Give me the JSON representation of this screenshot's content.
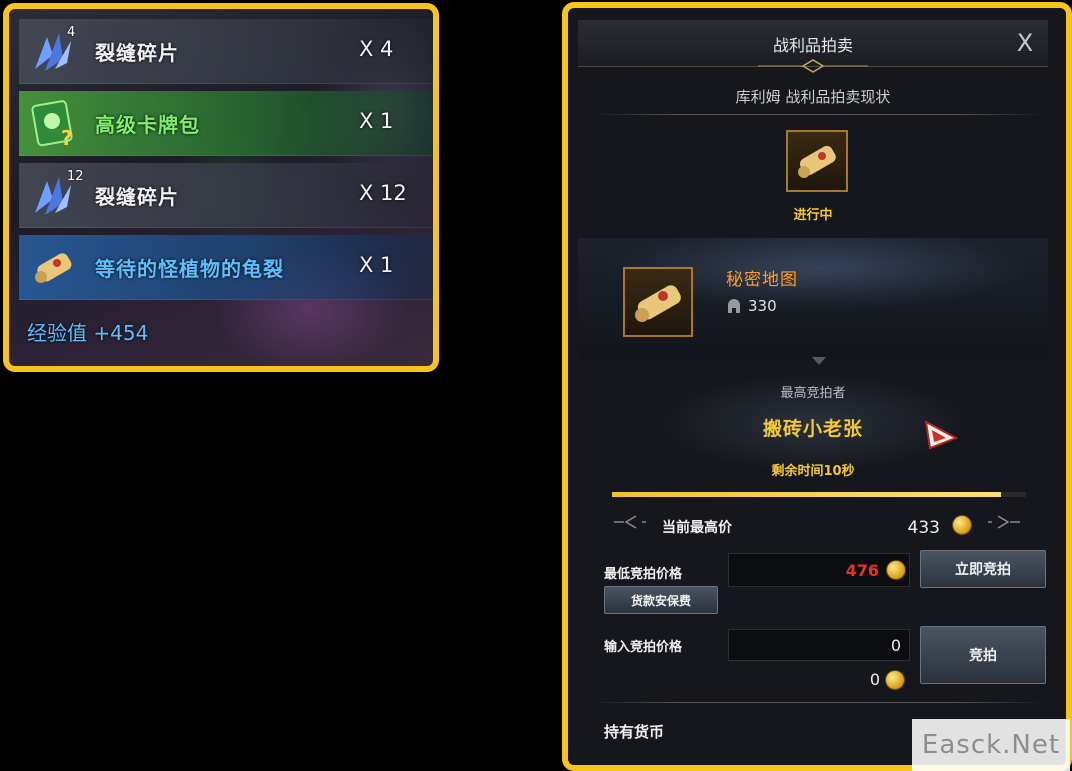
{
  "loot": {
    "items": [
      {
        "stack": "4",
        "name": "裂缝碎片",
        "qty": "X 4",
        "icon": "crystal-shard-icon"
      },
      {
        "stack": "",
        "name": "高级卡牌包",
        "qty": "X 1",
        "icon": "card-pack-icon"
      },
      {
        "stack": "12",
        "name": "裂缝碎片",
        "qty": "X 12",
        "icon": "crystal-shard-icon"
      },
      {
        "stack": "",
        "name": "等待的怪植物的龟裂",
        "qty": "X 1",
        "icon": "scroll-icon"
      }
    ],
    "exp": "经验值 +454"
  },
  "auction": {
    "title": "战利品拍卖",
    "close": "X",
    "subtitle": "库利姆 战利品拍卖现状",
    "status": "进行中",
    "item": {
      "name": "秘密地图",
      "level": "330",
      "icon": "scroll-icon"
    },
    "highest_bidder_label": "最高竞拍者",
    "highest_bidder": "搬砖小老张",
    "timer": "剩余时间10秒",
    "progress": 0.94,
    "current_price_label": "当前最高价",
    "current_price": "433",
    "min_bid_label": "最低竞拍价格",
    "min_bid": "476",
    "instant_bid_button": "立即竞拍",
    "deposit_button": "货款安保费",
    "input_bid_label": "输入竞拍价格",
    "input_bid_value": "0",
    "input_coin_value": "0",
    "bid_button": "竞拍",
    "holdings_label": "持有货币"
  },
  "watermark": "Easck.Net",
  "colors": {
    "frame": "#f8c31a",
    "accent_gold": "#f3c93a",
    "price_red": "#e8312a",
    "item_orange": "#ff9d2a"
  }
}
